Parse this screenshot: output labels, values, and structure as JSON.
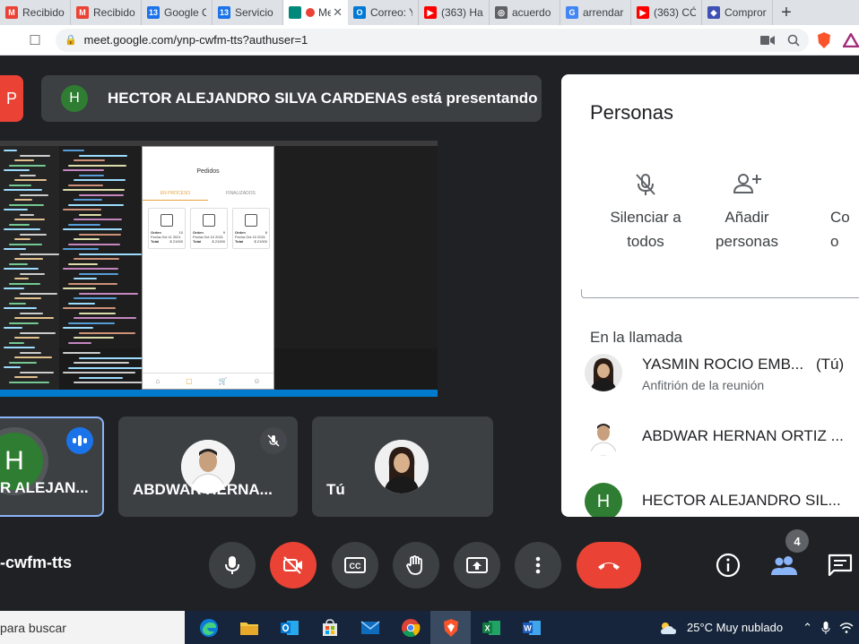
{
  "browser": {
    "tabs": [
      {
        "title": "Recibido",
        "icon": "gmail-icon",
        "color": "#ea4335",
        "glyph": "M"
      },
      {
        "title": "Recibido",
        "icon": "gmail-icon",
        "color": "#ea4335",
        "glyph": "M"
      },
      {
        "title": "Google C",
        "icon": "calendar-icon",
        "color": "#1a73e8",
        "glyph": "13"
      },
      {
        "title": "Servicio",
        "icon": "calendar-icon",
        "color": "#1a73e8",
        "glyph": "13"
      },
      {
        "title": "Me",
        "icon": "meet-icon",
        "color": "#00897b",
        "glyph": "",
        "active": true
      },
      {
        "title": "Correo: Y",
        "icon": "outlook-icon",
        "color": "#0078d4",
        "glyph": "O"
      },
      {
        "title": "(363) Har",
        "icon": "youtube-icon",
        "color": "#ff0000",
        "glyph": "▶"
      },
      {
        "title": "acuerdo",
        "icon": "globe-icon",
        "color": "#5f6368",
        "glyph": "◎"
      },
      {
        "title": "arrendar",
        "icon": "google-icon",
        "color": "#4285f4",
        "glyph": "G"
      },
      {
        "title": "(363) CÓ",
        "icon": "youtube-icon",
        "color": "#ff0000",
        "glyph": "▶"
      },
      {
        "title": "Compror",
        "icon": "app-icon",
        "color": "#3f51b5",
        "glyph": "◆"
      }
    ],
    "url": "meet.google.com/ynp-cwfm-tts?authuser=1",
    "new_tab": "+"
  },
  "meet": {
    "presenting_avatar": "H",
    "presenting_text": "HECTOR ALEJANDRO SILVA CARDENAS está presentando",
    "shared_app": {
      "title": "Pedidos",
      "tab_active": "EN PROCESO",
      "tab_other": "FINALIZADOS",
      "cards": [
        {
          "orden": "Orden",
          "orden_val": "10",
          "fecha": "Fecha Oct 11 2021",
          "total": "Total",
          "total_val": "$ 21000"
        },
        {
          "orden": "Orden",
          "orden_val": "9",
          "fecha": "Fecha Oct 10 2021",
          "total": "Total",
          "total_val": "$ 21000"
        },
        {
          "orden": "Orden",
          "orden_val": "8",
          "fecha": "Fecha Oct 10 2021",
          "total": "Total",
          "total_val": "$ 21000"
        }
      ]
    },
    "tiles": [
      {
        "name": "R ALEJAN...",
        "avatar": "H"
      },
      {
        "name": "ABDWAR HERNA..."
      },
      {
        "name": "Tú"
      }
    ],
    "meeting_code": "-cwfm-tts",
    "participant_count": "4"
  },
  "panel": {
    "title": "Personas",
    "actions": [
      {
        "label_line1": "Silenciar a",
        "label_line2": "todos"
      },
      {
        "label_line1": "Añadir",
        "label_line2": "personas"
      },
      {
        "label_line1": "Co",
        "label_line2": "o"
      }
    ],
    "section": "En la llamada",
    "people": [
      {
        "name": "YASMIN ROCIO EMB...",
        "you": "(Tú)",
        "role": "Anfitrión de la reunión"
      },
      {
        "name": "ABDWAR HERNAN ORTIZ ..."
      },
      {
        "name": "HECTOR ALEJANDRO SIL...",
        "avatar": "H"
      }
    ]
  },
  "taskbar": {
    "search": "para buscar",
    "weather": "25°C  Muy nublado"
  },
  "colors": {
    "meet_bg": "#202124",
    "tile_bg": "#3c4043",
    "accent_red": "#ea4335",
    "accent_blue": "#1a73e8",
    "avatar_green": "#2e7d32"
  }
}
